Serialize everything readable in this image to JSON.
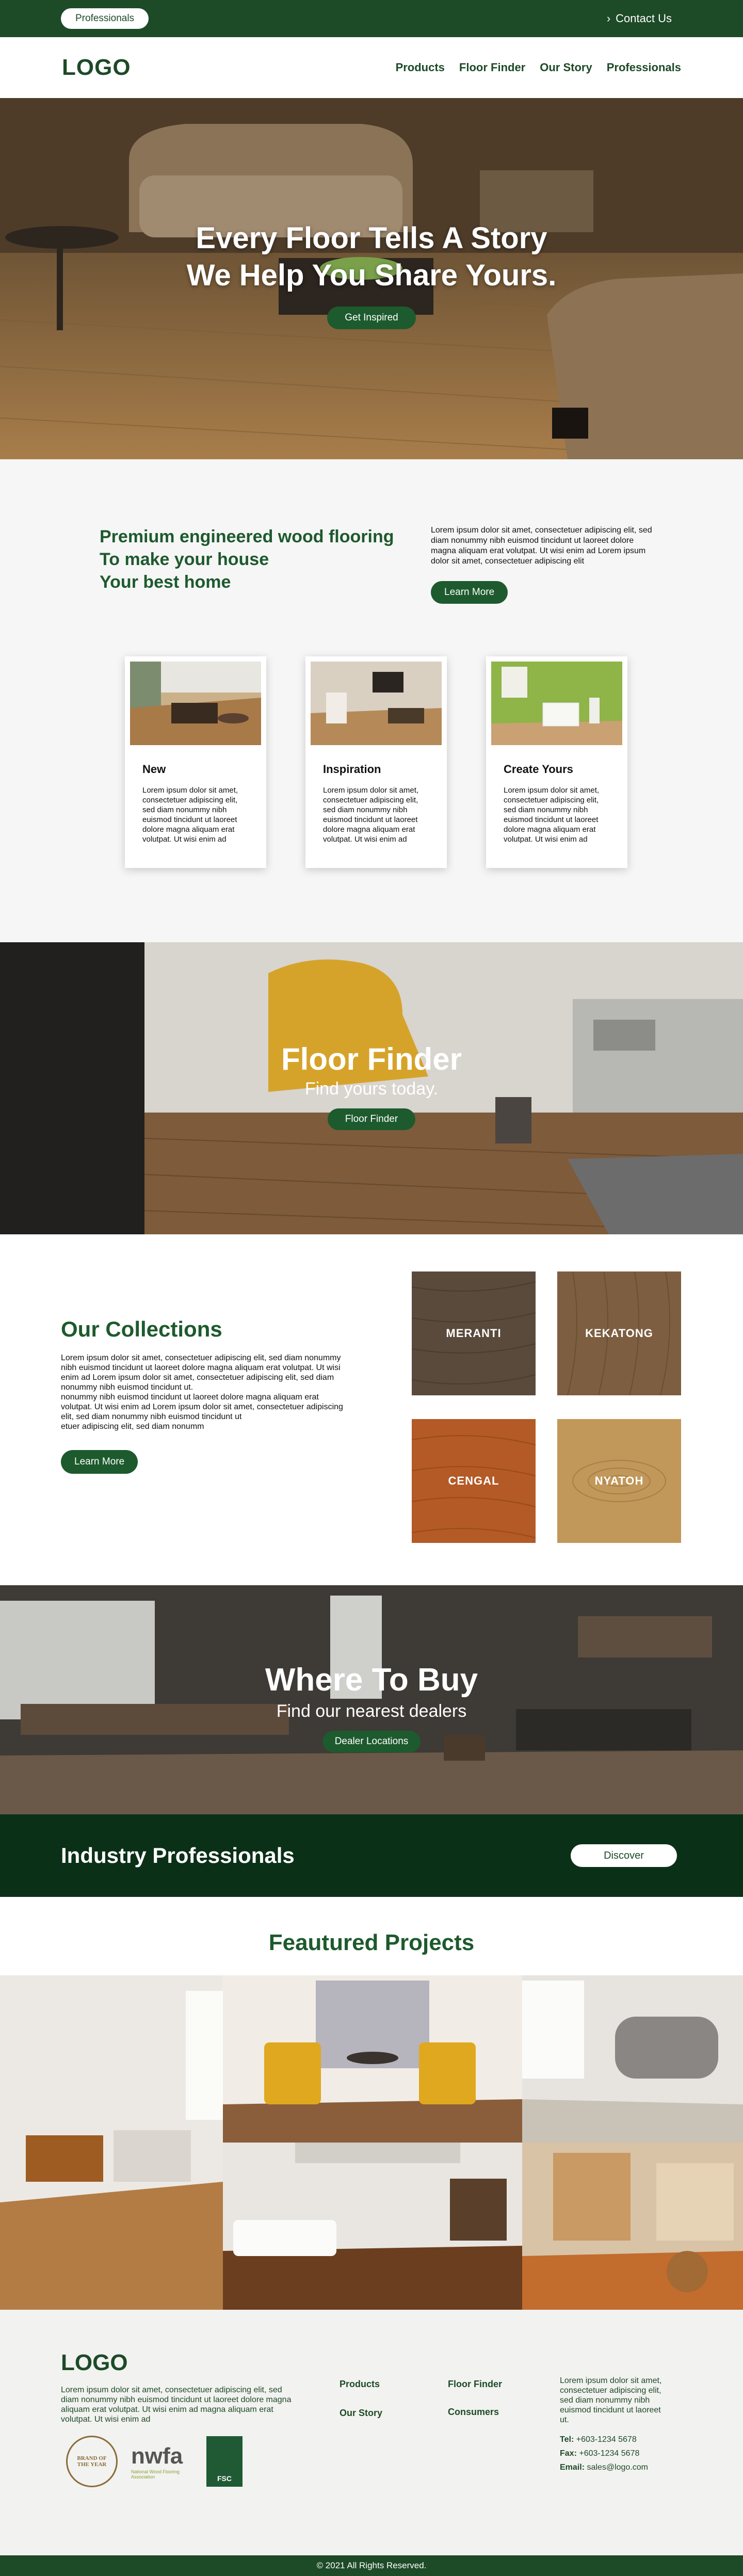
{
  "topbar": {
    "professionals_label": "Professionals",
    "contact_label": "Contact Us"
  },
  "nav": {
    "logo": "LOGO",
    "links": [
      "Products",
      "Floor Finder",
      "Our Story",
      "Professionals"
    ]
  },
  "hero": {
    "line1": "Every Floor Tells A Story",
    "line2": "We Help You Share Yours.",
    "cta": "Get Inspired"
  },
  "intro": {
    "heading1": "Premium engineered wood flooring",
    "heading2": "To make your house",
    "heading3": "Your best home",
    "body": "Lorem ipsum dolor sit amet, consectetuer adipiscing elit, sed diam nonummy nibh euismod tincidunt ut laoreet dolore magna aliquam erat volutpat. Ut wisi enim ad Lorem ipsum dolor sit amet, consectetuer adipiscing elit",
    "cta": "Learn More",
    "cards": [
      {
        "title": "New",
        "body": "Lorem ipsum dolor sit amet, consectetuer adipiscing elit, sed diam nonummy nibh euismod tincidunt ut laoreet dolore magna aliquam erat volutpat. Ut wisi enim ad"
      },
      {
        "title": "Inspiration",
        "body": "Lorem ipsum dolor sit amet, consectetuer adipiscing elit, sed diam nonummy nibh euismod tincidunt ut laoreet dolore magna aliquam erat volutpat. Ut wisi enim ad"
      },
      {
        "title": "Create Yours",
        "body": "Lorem ipsum dolor sit amet, consectetuer adipiscing elit, sed diam nonummy nibh euismod tincidunt ut laoreet dolore magna aliquam erat volutpat. Ut wisi enim ad"
      }
    ]
  },
  "floor_finder": {
    "title": "Floor Finder",
    "subtitle": "Find yours today.",
    "cta": "Floor Finder"
  },
  "collections": {
    "title": "Our Collections",
    "body1": "Lorem ipsum dolor sit amet, consectetuer adipiscing elit, sed diam nonummy nibh euismod tincidunt ut laoreet dolore magna aliquam erat volutpat. Ut wisi enim ad Lorem ipsum dolor sit amet, consectetuer adipiscing elit, sed diam nonummy nibh euismod tincidunt ut.",
    "body2": "nonummy nibh euismod tincidunt ut laoreet dolore magna aliquam erat volutpat. Ut wisi enim ad Lorem ipsum dolor sit amet, consectetuer adipiscing elit, sed diam nonummy nibh euismod tincidunt ut",
    "body3": "etuer adipiscing elit, sed diam nonumm",
    "cta": "Learn More",
    "swatches": [
      "MERANTI",
      "KEKATONG",
      "CENGAL",
      "NYATOH"
    ]
  },
  "where_to_buy": {
    "title": "Where To Buy",
    "subtitle": "Find our nearest dealers",
    "cta": "Dealer Locations"
  },
  "industry": {
    "title": "Industry Professionals",
    "cta": "Discover"
  },
  "featured": {
    "title": "Feautured Projects"
  },
  "footer": {
    "logo": "LOGO",
    "body": "Lorem ipsum dolor sit amet, consectetuer adipiscing elit, sed diam nonummy nibh euismod tincidunt ut laoreet dolore magna aliquam erat volutpat. Ut wisi enim ad magna aliquam erat volutpat. Ut wisi enim ad",
    "links": [
      "Products",
      "Floor Finder",
      "Our Story",
      "Consumers"
    ],
    "right_text": "Lorem ipsum dolor sit amet, consectetuer adipiscing elit, sed diam nonummy nibh euismod tincidunt ut laoreet ut.",
    "tel_label": "Tel:",
    "tel": "+603-1234 5678",
    "fax_label": "Fax:",
    "fax": "+603-1234 5678",
    "email_label": "Email:",
    "email": "sales@logo.com",
    "badges": {
      "brand_year": "BRAND OF THE YEAR",
      "nwfa": "nwfa",
      "nwfa_sub": "National Wood Flooring Association",
      "fsc": "FSC"
    },
    "copyright": "© 2021 All Rights Reserved."
  },
  "colors": {
    "brand_green": "#1d4a27",
    "accent_green": "#1d5a2d",
    "dark_green": "#0b3018"
  }
}
